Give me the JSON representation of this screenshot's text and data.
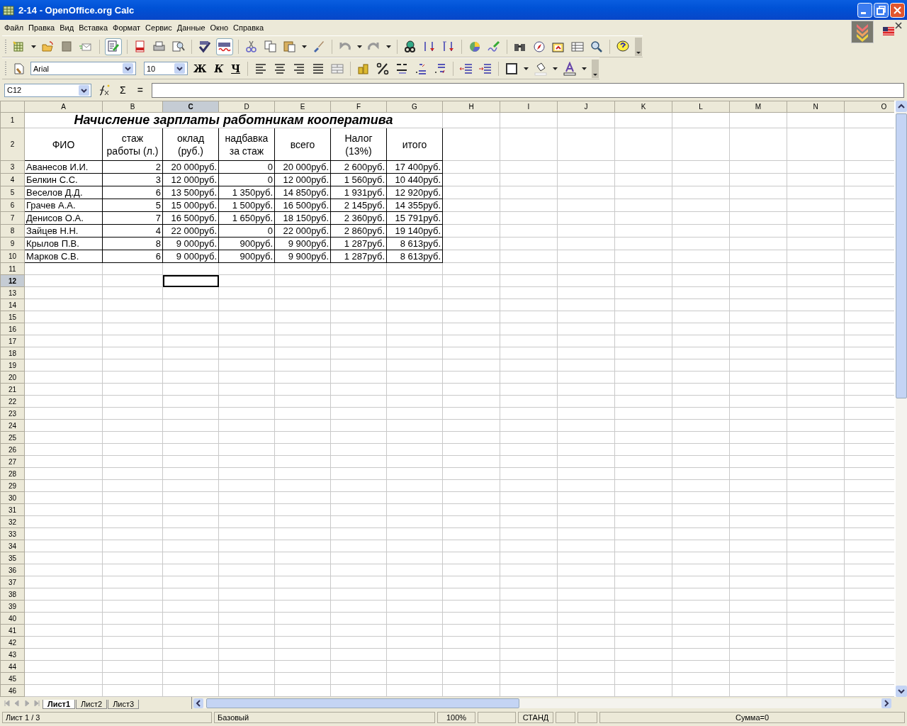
{
  "window": {
    "title": "2-14 - OpenOffice.org Calc"
  },
  "menu": [
    "Файл",
    "Правка",
    "Вид",
    "Вставка",
    "Формат",
    "Сервис",
    "Данные",
    "Окно",
    "Справка"
  ],
  "format_bar": {
    "font": "Arial",
    "size": "10",
    "bold": "Ж",
    "italic": "К",
    "underline": "Ч"
  },
  "formula_bar": {
    "name_box": "C12",
    "sum": "Σ",
    "equals": "="
  },
  "sheet": {
    "columns": [
      {
        "label": "A",
        "selected": false
      },
      {
        "label": "B",
        "selected": false
      },
      {
        "label": "C",
        "selected": true
      },
      {
        "label": "D",
        "selected": false
      },
      {
        "label": "E",
        "selected": false
      },
      {
        "label": "F",
        "selected": false
      },
      {
        "label": "G",
        "selected": false
      },
      {
        "label": "H",
        "selected": false
      },
      {
        "label": "I",
        "selected": false
      },
      {
        "label": "J",
        "selected": false
      },
      {
        "label": "K",
        "selected": false
      },
      {
        "label": "L",
        "selected": false
      },
      {
        "label": "M",
        "selected": false
      },
      {
        "label": "N",
        "selected": false
      },
      {
        "label": "O",
        "selected": false
      }
    ],
    "rows": [
      {
        "label": "1",
        "selected": false
      },
      {
        "label": "2",
        "selected": false
      },
      {
        "label": "3",
        "selected": false
      },
      {
        "label": "4",
        "selected": false
      },
      {
        "label": "5",
        "selected": false
      },
      {
        "label": "6",
        "selected": false
      },
      {
        "label": "7",
        "selected": false
      },
      {
        "label": "8",
        "selected": false
      },
      {
        "label": "9",
        "selected": false
      },
      {
        "label": "10",
        "selected": false
      },
      {
        "label": "11",
        "selected": false
      },
      {
        "label": "12",
        "selected": true
      },
      {
        "label": "13",
        "selected": false
      },
      {
        "label": "14",
        "selected": false
      },
      {
        "label": "15",
        "selected": false
      },
      {
        "label": "16",
        "selected": false
      },
      {
        "label": "17",
        "selected": false
      },
      {
        "label": "18",
        "selected": false
      },
      {
        "label": "19",
        "selected": false
      },
      {
        "label": "20",
        "selected": false
      },
      {
        "label": "21",
        "selected": false
      },
      {
        "label": "22",
        "selected": false
      },
      {
        "label": "23",
        "selected": false
      },
      {
        "label": "24",
        "selected": false
      },
      {
        "label": "25",
        "selected": false
      },
      {
        "label": "26",
        "selected": false
      },
      {
        "label": "27",
        "selected": false
      },
      {
        "label": "28",
        "selected": false
      },
      {
        "label": "29",
        "selected": false
      },
      {
        "label": "30",
        "selected": false
      },
      {
        "label": "31",
        "selected": false
      },
      {
        "label": "32",
        "selected": false
      },
      {
        "label": "33",
        "selected": false
      },
      {
        "label": "34",
        "selected": false
      },
      {
        "label": "35",
        "selected": false
      },
      {
        "label": "36",
        "selected": false
      },
      {
        "label": "37",
        "selected": false
      },
      {
        "label": "38",
        "selected": false
      },
      {
        "label": "39",
        "selected": false
      },
      {
        "label": "40",
        "selected": false
      },
      {
        "label": "41",
        "selected": false
      },
      {
        "label": "42",
        "selected": false
      },
      {
        "label": "43",
        "selected": false
      },
      {
        "label": "44",
        "selected": false
      },
      {
        "label": "45",
        "selected": false
      },
      {
        "label": "46",
        "selected": false
      }
    ],
    "title": "Начисление зарплаты работникам кооператива",
    "header": [
      "ФИО",
      "стаж работы (л.)",
      "оклад (руб.)",
      "надбавка за стаж",
      "всего",
      "Налог (13%)",
      "итого"
    ],
    "data": [
      [
        "Аванесов И.И.",
        "2",
        "20 000руб.",
        "0",
        "20 000руб.",
        "2 600руб.",
        "17 400руб."
      ],
      [
        "Белкин С.С.",
        "3",
        "12 000руб.",
        "0",
        "12 000руб.",
        "1 560руб.",
        "10 440руб."
      ],
      [
        "Веселов Д.Д.",
        "6",
        "13 500руб.",
        "1 350руб.",
        "14 850руб.",
        "1 931руб.",
        "12 920руб."
      ],
      [
        "Грачев А.А.",
        "5",
        "15 000руб.",
        "1 500руб.",
        "16 500руб.",
        "2 145руб.",
        "14 355руб."
      ],
      [
        "Денисов О.А.",
        "7",
        "16 500руб.",
        "1 650руб.",
        "18 150руб.",
        "2 360руб.",
        "15 791руб."
      ],
      [
        "Зайцев Н.Н.",
        "4",
        "22 000руб.",
        "0",
        "22 000руб.",
        "2 860руб.",
        "19 140руб."
      ],
      [
        "Крылов П.В.",
        "8",
        "9 000руб.",
        "900руб.",
        "9 900руб.",
        "1 287руб.",
        "8 613руб."
      ],
      [
        "Марков С.В.",
        "6",
        "9 000руб.",
        "900руб.",
        "9 900руб.",
        "1 287руб.",
        "8 613руб."
      ]
    ]
  },
  "sheet_tabs": [
    {
      "label": "Лист1",
      "selected": true
    },
    {
      "label": "Лист2",
      "selected": false
    },
    {
      "label": "Лист3",
      "selected": false
    }
  ],
  "status_bar": [
    "Лист 1 / 3",
    "Базовый",
    "100%",
    "СТАНД",
    "Сумма=0"
  ]
}
